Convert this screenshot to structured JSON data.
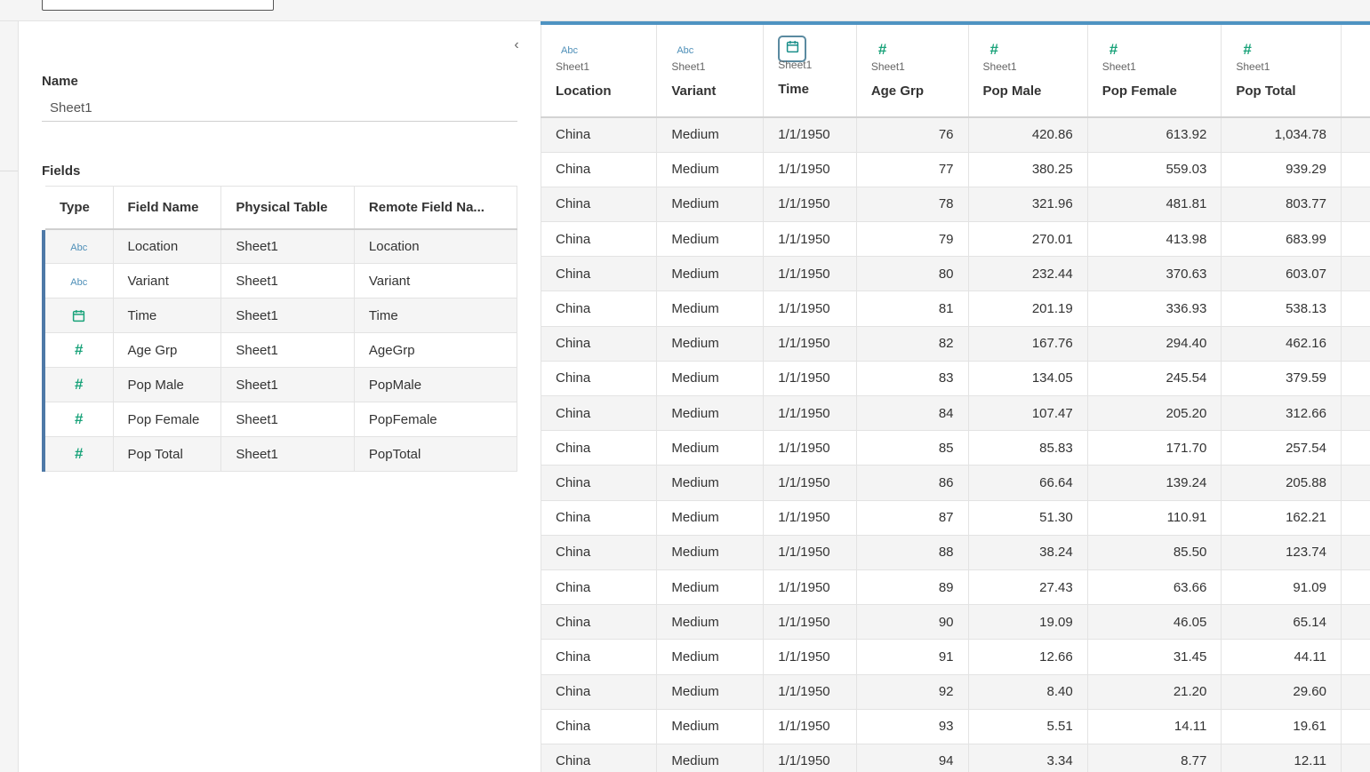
{
  "header": {
    "sheet_select_value": ""
  },
  "panel": {
    "name_label": "Name",
    "name_value": "Sheet1",
    "fields_label": "Fields",
    "fields_columns": [
      "Type",
      "Field Name",
      "Physical Table",
      "Remote Field Na..."
    ],
    "fields": [
      {
        "type": "string",
        "type_label": "Abc",
        "name": "Location",
        "table": "Sheet1",
        "remote": "Location"
      },
      {
        "type": "string",
        "type_label": "Abc",
        "name": "Variant",
        "table": "Sheet1",
        "remote": "Variant"
      },
      {
        "type": "date",
        "type_label": "calendar-icon",
        "name": "Time",
        "table": "Sheet1",
        "remote": "Time"
      },
      {
        "type": "number",
        "type_label": "#",
        "name": "Age Grp",
        "table": "Sheet1",
        "remote": "AgeGrp"
      },
      {
        "type": "number",
        "type_label": "#",
        "name": "Pop Male",
        "table": "Sheet1",
        "remote": "PopMale"
      },
      {
        "type": "number",
        "type_label": "#",
        "name": "Pop Female",
        "table": "Sheet1",
        "remote": "PopFemale"
      },
      {
        "type": "number",
        "type_label": "#",
        "name": "Pop Total",
        "table": "Sheet1",
        "remote": "PopTotal"
      }
    ]
  },
  "grid": {
    "columns": [
      {
        "type": "string",
        "icon": "Abc",
        "source": "Sheet1",
        "name": "Location"
      },
      {
        "type": "string",
        "icon": "Abc",
        "source": "Sheet1",
        "name": "Variant"
      },
      {
        "type": "date",
        "icon": "calendar-icon",
        "source": "Sheet1",
        "name": "Time"
      },
      {
        "type": "number",
        "icon": "#",
        "source": "Sheet1",
        "name": "Age Grp"
      },
      {
        "type": "number",
        "icon": "#",
        "source": "Sheet1",
        "name": "Pop Male"
      },
      {
        "type": "number",
        "icon": "#",
        "source": "Sheet1",
        "name": "Pop Female"
      },
      {
        "type": "number",
        "icon": "#",
        "source": "Sheet1",
        "name": "Pop Total"
      }
    ],
    "rows": [
      [
        "China",
        "Medium",
        "1/1/1950",
        "76",
        "420.86",
        "613.92",
        "1,034.78"
      ],
      [
        "China",
        "Medium",
        "1/1/1950",
        "77",
        "380.25",
        "559.03",
        "939.29"
      ],
      [
        "China",
        "Medium",
        "1/1/1950",
        "78",
        "321.96",
        "481.81",
        "803.77"
      ],
      [
        "China",
        "Medium",
        "1/1/1950",
        "79",
        "270.01",
        "413.98",
        "683.99"
      ],
      [
        "China",
        "Medium",
        "1/1/1950",
        "80",
        "232.44",
        "370.63",
        "603.07"
      ],
      [
        "China",
        "Medium",
        "1/1/1950",
        "81",
        "201.19",
        "336.93",
        "538.13"
      ],
      [
        "China",
        "Medium",
        "1/1/1950",
        "82",
        "167.76",
        "294.40",
        "462.16"
      ],
      [
        "China",
        "Medium",
        "1/1/1950",
        "83",
        "134.05",
        "245.54",
        "379.59"
      ],
      [
        "China",
        "Medium",
        "1/1/1950",
        "84",
        "107.47",
        "205.20",
        "312.66"
      ],
      [
        "China",
        "Medium",
        "1/1/1950",
        "85",
        "85.83",
        "171.70",
        "257.54"
      ],
      [
        "China",
        "Medium",
        "1/1/1950",
        "86",
        "66.64",
        "139.24",
        "205.88"
      ],
      [
        "China",
        "Medium",
        "1/1/1950",
        "87",
        "51.30",
        "110.91",
        "162.21"
      ],
      [
        "China",
        "Medium",
        "1/1/1950",
        "88",
        "38.24",
        "85.50",
        "123.74"
      ],
      [
        "China",
        "Medium",
        "1/1/1950",
        "89",
        "27.43",
        "63.66",
        "91.09"
      ],
      [
        "China",
        "Medium",
        "1/1/1950",
        "90",
        "19.09",
        "46.05",
        "65.14"
      ],
      [
        "China",
        "Medium",
        "1/1/1950",
        "91",
        "12.66",
        "31.45",
        "44.11"
      ],
      [
        "China",
        "Medium",
        "1/1/1950",
        "92",
        "8.40",
        "21.20",
        "29.60"
      ],
      [
        "China",
        "Medium",
        "1/1/1950",
        "93",
        "5.51",
        "14.11",
        "19.61"
      ],
      [
        "China",
        "Medium",
        "1/1/1950",
        "94",
        "3.34",
        "8.77",
        "12.11"
      ]
    ]
  },
  "colors": {
    "accent_blue": "#4e93c2",
    "string_icon": "#4e8fb8",
    "number_icon": "#1aa37a",
    "row_alt": "#f4f4f4"
  }
}
